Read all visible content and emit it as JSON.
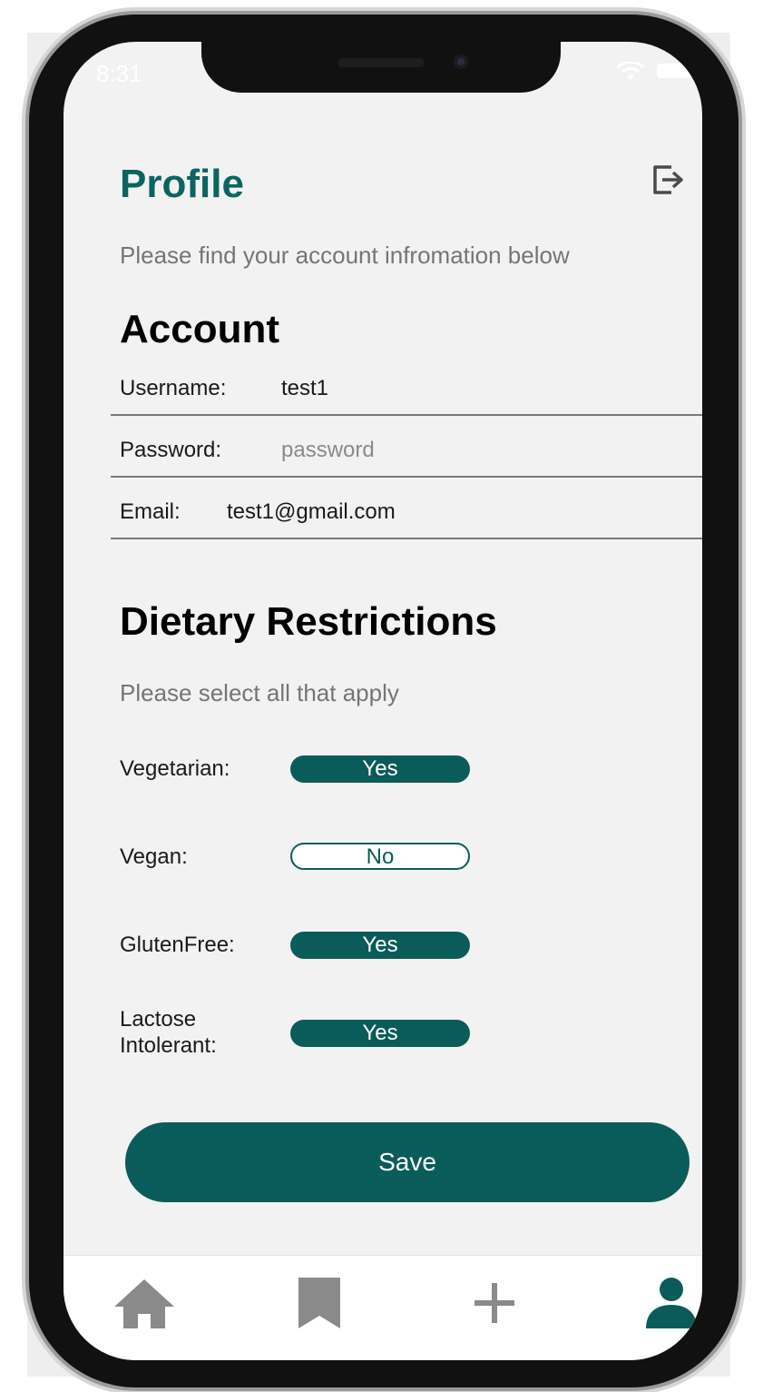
{
  "status_bar": {
    "time": "8:31"
  },
  "header": {
    "title": "Profile",
    "subtitle": "Please find your account infromation below"
  },
  "account": {
    "heading": "Account",
    "username": {
      "label": "Username:",
      "value": "test1"
    },
    "password": {
      "label": "Password:",
      "placeholder": "password"
    },
    "email": {
      "label": "Email:",
      "value": "test1@gmail.com"
    }
  },
  "dietary": {
    "heading": "Dietary Restrictions",
    "subtitle": "Please select all that apply",
    "items": [
      {
        "label": "Vegetarian:",
        "value": "Yes"
      },
      {
        "label": "Vegan:",
        "value": "No"
      },
      {
        "label": "GlutenFree:",
        "value": "Yes"
      },
      {
        "label": "Lactose Intolerant:",
        "value": "Yes"
      }
    ]
  },
  "save_label": "Save",
  "tabs": [
    {
      "icon": "home-icon"
    },
    {
      "icon": "bookmark-icon"
    },
    {
      "icon": "plus-icon"
    },
    {
      "icon": "profile-icon",
      "active": true
    }
  ],
  "colors": {
    "accent": "#0a5c5a",
    "title": "#0a6560",
    "inactive_icon": "#8a8a8a",
    "background": "#f2f2f2"
  }
}
